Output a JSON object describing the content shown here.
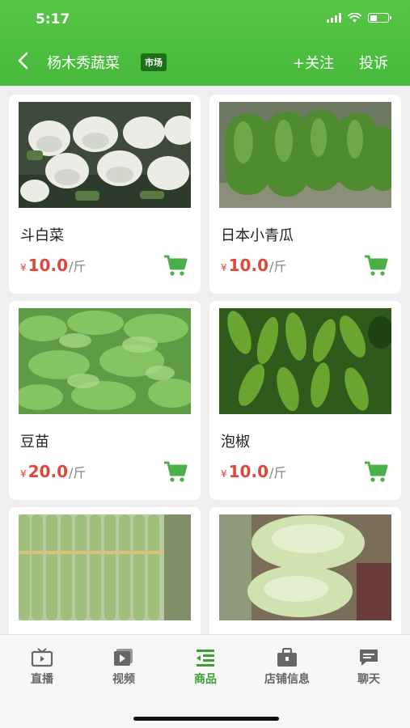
{
  "status_bar": {
    "time": "5:17"
  },
  "header": {
    "shop_name": "杨木秀蔬菜",
    "tag": "市场",
    "follow_label": "+关注",
    "complain_label": "投诉"
  },
  "products": [
    {
      "name": "斗白菜",
      "currency": "¥",
      "price": "10.0",
      "unit": "/斤"
    },
    {
      "name": "日本小青瓜",
      "currency": "¥",
      "price": "10.0",
      "unit": "/斤"
    },
    {
      "name": "豆苗",
      "currency": "¥",
      "price": "20.0",
      "unit": "/斤"
    },
    {
      "name": "泡椒",
      "currency": "¥",
      "price": "10.0",
      "unit": "/斤"
    },
    {
      "name": "",
      "currency": "",
      "price": "",
      "unit": ""
    },
    {
      "name": "",
      "currency": "",
      "price": "",
      "unit": ""
    }
  ],
  "tabbar": {
    "items": [
      {
        "label": "直播",
        "icon": "live-tv-icon"
      },
      {
        "label": "视频",
        "icon": "video-icon"
      },
      {
        "label": "商品",
        "icon": "product-list-icon"
      },
      {
        "label": "店铺信息",
        "icon": "briefcase-icon"
      },
      {
        "label": "聊天",
        "icon": "chat-icon"
      }
    ],
    "active_index": 2
  },
  "colors": {
    "brand_green": "#4cbe3f",
    "price_red": "#e0463a",
    "active_tab": "#3a9e30"
  }
}
